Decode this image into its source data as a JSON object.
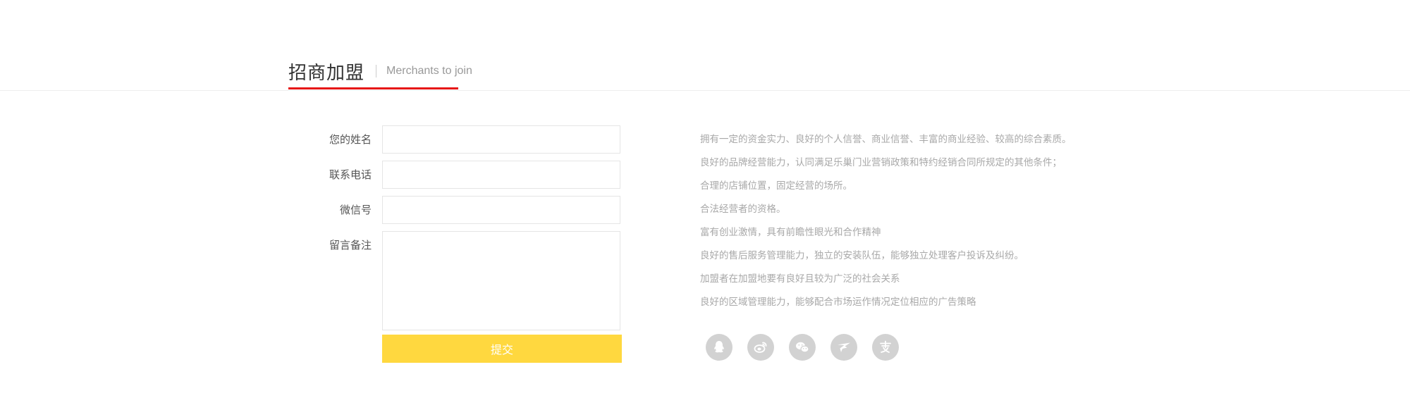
{
  "header": {
    "title": "招商加盟",
    "subtitle": "Merchants to join"
  },
  "form": {
    "name_label": "您的姓名",
    "phone_label": "联系电话",
    "wechat_label": "微信号",
    "message_label": "留言备注",
    "name_value": "",
    "phone_value": "",
    "wechat_value": "",
    "message_value": "",
    "submit_label": "提交"
  },
  "requirements": [
    "拥有一定的资金实力、良好的个人信誉、商业信誉、丰富的商业经验、较高的综合素质。",
    "良好的品牌经营能力，认同满足乐巢门业营销政策和特约经销合同所规定的其他条件；",
    "合理的店铺位置，固定经营的场所。",
    "合法经营者的资格。",
    "富有创业激情，具有前瞻性眼光和合作精神",
    "良好的售后服务管理能力，独立的安装队伍，能够独立处理客户投诉及纠纷。",
    "加盟者在加盟地要有良好且较为广泛的社会关系",
    "良好的区域管理能力，能够配合市场运作情况定位相应的广告策略"
  ],
  "social": [
    "qq-icon",
    "weibo-icon",
    "wechat-icon",
    "tencent-weibo-icon",
    "alipay-icon"
  ],
  "colors": {
    "accent_red": "#e61717",
    "submit_yellow": "#ffd83f",
    "icon_gray": "#d2d2d2"
  }
}
